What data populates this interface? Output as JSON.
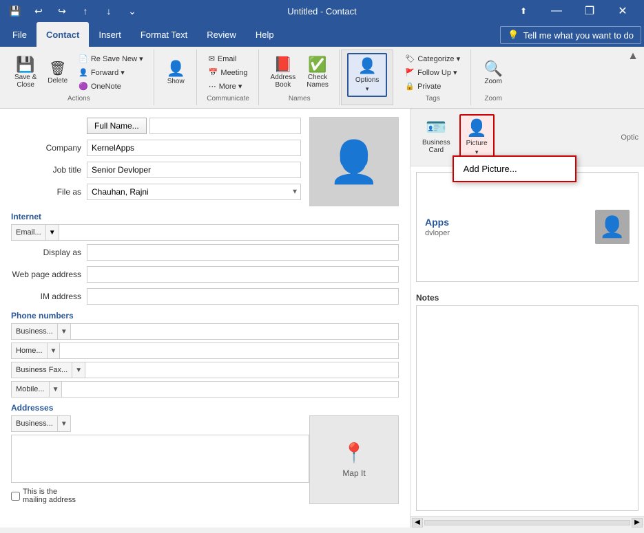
{
  "titleBar": {
    "title": "Untitled - Contact",
    "minimize": "—",
    "restore": "❐",
    "close": "✕",
    "collapseRibbon": "⬆"
  },
  "quickAccess": {
    "save": "💾",
    "undo": "↩",
    "redo": "↪",
    "up": "↑",
    "down": "↓",
    "arrow": "⌄"
  },
  "tabs": [
    {
      "id": "file",
      "label": "File"
    },
    {
      "id": "contact",
      "label": "Contact",
      "active": true
    },
    {
      "id": "insert",
      "label": "Insert"
    },
    {
      "id": "format",
      "label": "Format Text"
    },
    {
      "id": "review",
      "label": "Review"
    },
    {
      "id": "help",
      "label": "Help"
    }
  ],
  "tellMe": {
    "icon": "💡",
    "placeholder": "Tell me what you want to do"
  },
  "ribbon": {
    "groups": [
      {
        "id": "actions",
        "label": "Actions",
        "items": [
          {
            "id": "save-close",
            "icon": "💾",
            "label": "Save &\nClose",
            "large": true
          },
          {
            "id": "delete",
            "icon": "🗑",
            "label": "Delete",
            "large": true
          }
        ],
        "subItems": [
          {
            "id": "save-new",
            "icon": "📄",
            "label": "Save & New ▾"
          },
          {
            "id": "forward",
            "icon": "👤",
            "label": "Forward ▾"
          },
          {
            "id": "onenote",
            "icon": "🟣",
            "label": "OneNote"
          }
        ]
      },
      {
        "id": "show",
        "label": "",
        "items": [
          {
            "id": "show",
            "icon": "👤",
            "label": "Show",
            "large": true
          }
        ]
      },
      {
        "id": "communicate",
        "label": "Communicate",
        "items": [
          {
            "id": "email",
            "icon": "✉",
            "label": "Email"
          },
          {
            "id": "meeting",
            "icon": "📅",
            "label": "Meeting"
          },
          {
            "id": "more",
            "icon": "⋯",
            "label": "More ▾"
          }
        ]
      },
      {
        "id": "names",
        "label": "Names",
        "items": [
          {
            "id": "address-book",
            "icon": "📕",
            "label": "Address\nBook",
            "large": true
          },
          {
            "id": "check-names",
            "icon": "✅",
            "label": "Check\nNames",
            "large": true
          }
        ]
      },
      {
        "id": "options",
        "label": "",
        "items": [
          {
            "id": "options-btn",
            "icon": "👤",
            "label": "Options",
            "large": true,
            "active": true
          }
        ]
      },
      {
        "id": "tags",
        "label": "Tags",
        "items": [
          {
            "id": "categorize",
            "icon": "🏷",
            "label": "Categorize ▾"
          },
          {
            "id": "follow-up",
            "icon": "🚩",
            "label": "Follow Up ▾"
          },
          {
            "id": "private",
            "icon": "🔒",
            "label": "Private"
          }
        ]
      },
      {
        "id": "zoom",
        "label": "Zoom",
        "items": [
          {
            "id": "zoom-btn",
            "icon": "🔍",
            "label": "Zoom",
            "large": true
          }
        ]
      }
    ]
  },
  "form": {
    "fullNameLabel": "Full Name...",
    "companyLabel": "Company",
    "companyValue": "KernelApps",
    "jobTitleLabel": "Job title",
    "jobTitleValue": "Senior Devloper",
    "fileAsLabel": "File as",
    "fileAsValue": "Chauhan, Rajni",
    "internetLabel": "Internet",
    "emailLabel": "Email...",
    "displayAsLabel": "Display as",
    "webPageLabel": "Web page address",
    "imAddressLabel": "IM address",
    "phoneLabel": "Phone numbers",
    "businessLabel": "Business...",
    "homeLabel": "Home...",
    "businessFaxLabel": "Business Fax...",
    "mobileLabel": "Mobile...",
    "addressesLabel": "Addresses",
    "businessAddrLabel": "Business...",
    "mailingLabel": "This is the\nmailing address",
    "mapIt": "Map It"
  },
  "rightPanel": {
    "businessCardLabel": "Business\nCard",
    "pictureLabel": "Picture",
    "pictureCaret": "▾",
    "optionsLabel": "Optic",
    "bcName": "Apps",
    "bcTitle": "dvloper",
    "notesLabel": "Notes",
    "addPictureLabel": "Add Picture..."
  }
}
